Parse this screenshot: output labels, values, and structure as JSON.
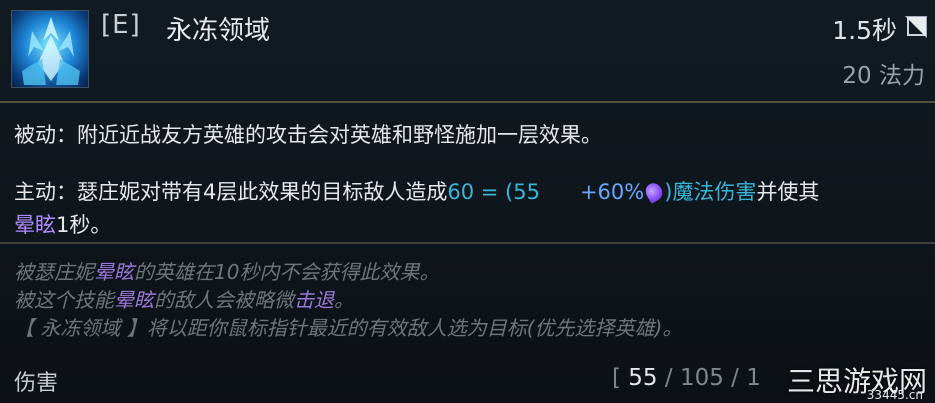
{
  "ability": {
    "key": "[E]",
    "name": "永冻领域",
    "cooldown": "1.5秒",
    "cost": "20 法力",
    "icon": "ice-crystal-icon"
  },
  "passive": {
    "label": "被动：",
    "text": "附近近战友方英雄的攻击会对英雄和野怪施加一层效果。"
  },
  "active": {
    "label": "主动：",
    "text_1": "瑟庄妮对带有4层此效果的目标敌人造成",
    "damage_formula": "60 = (55",
    "ratio": "+60%",
    "close_paren": ")",
    "damage_type": "魔法伤害",
    "text_2": "并使其",
    "stun": "晕眩",
    "text_3": "1秒。"
  },
  "notes": {
    "line1_a": "被瑟庄妮",
    "line1_stun": "晕眩",
    "line1_b": "的英雄在10秒内不会获得此效果。",
    "line2_a": "被这个技能",
    "line2_stun": "晕眩",
    "line2_b": "的敌人会被略微",
    "line2_knock": "击退",
    "line2_c": "。",
    "line3": "【 永冻领域 】将以距你鼠标指针最近的有效敌人选为目标(优先选择英雄)。"
  },
  "footer": {
    "label": "伤害",
    "open": "[ ",
    "current": "55",
    "sep1": " / ",
    "next": "105",
    "sep2": " / 1"
  },
  "watermark": {
    "text": "三思游戏网",
    "url": "33445.cn"
  },
  "colors": {
    "teal": "#38b6d8",
    "purple": "#b38bff",
    "divider": "#56503f"
  }
}
